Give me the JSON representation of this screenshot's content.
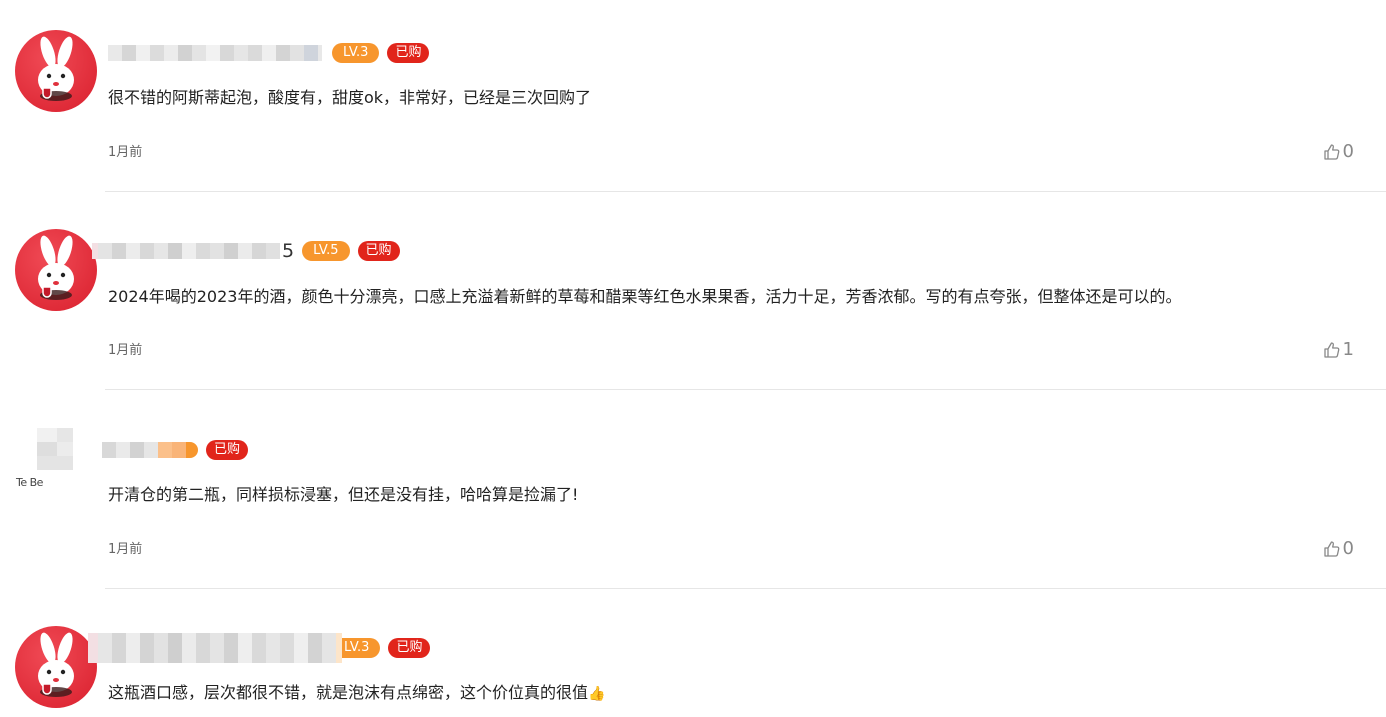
{
  "comments": [
    {
      "name_suffix": "",
      "level": "LV.3",
      "bought": "已购",
      "text": "很不错的阿斯蒂起泡，酸度有，甜度ok，非常好，已经是三次回购了",
      "time": "1月前",
      "likes": "0"
    },
    {
      "name_suffix": "5",
      "level": "LV.5",
      "bought": "已购",
      "text": "2024年喝的2023年的酒，颜色十分漂亮，口感上充溢着新鲜的草莓和醋栗等红色水果果香，活力十足，芳香浓郁。写的有点夸张，但整体还是可以的。",
      "time": "1月前",
      "likes": "1"
    },
    {
      "name_suffix": "",
      "level": "",
      "bought": "已购",
      "avatar_caption": "Te         Be",
      "text": "开清仓的第二瓶，同样损标浸塞，但还是没有挂，哈哈算是捡漏了!",
      "time": "1月前",
      "likes": "0"
    },
    {
      "name_suffix": "",
      "level": "LV.3",
      "bought": "已购",
      "text": "这瓶酒口感，层次都很不错，就是泡沫有点绵密，这个价位真的很值",
      "emoji": "👍",
      "time": "",
      "likes": ""
    }
  ],
  "colors": {
    "level_badge": "#f7962d",
    "bought_badge": "#e1251b",
    "avatar_red": "#e0303c",
    "divider": "#e6e6e6"
  },
  "icons": {
    "avatar": "bunny-avatar-icon",
    "like": "thumbs-up-icon"
  }
}
